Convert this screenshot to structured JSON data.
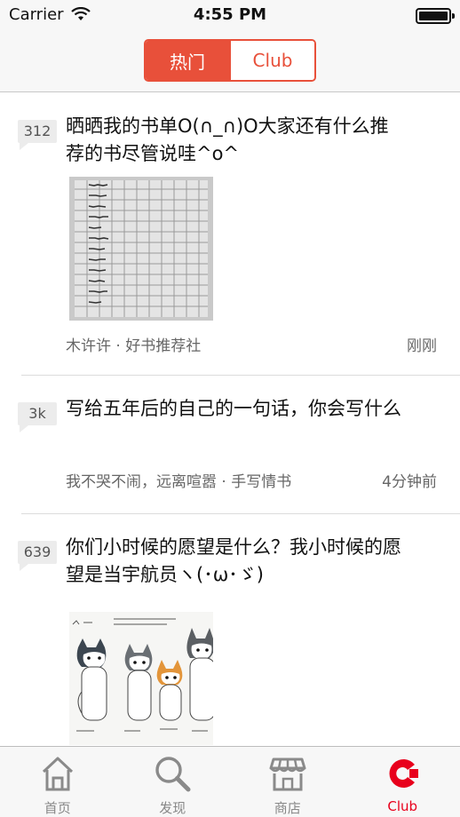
{
  "status_bar": {
    "carrier": "Carrier",
    "time": "4:55 PM"
  },
  "nav": {
    "segments": [
      {
        "label": "热门",
        "selected": true
      },
      {
        "label": "Club",
        "selected": false
      }
    ],
    "accent_color": "#e8503a"
  },
  "posts": [
    {
      "count": "312",
      "title": "晒晒我的书单O(∩_∩)O大家还有什么推荐的书尽管说哇^o^",
      "author_group": "木许许 · 好书推荐社",
      "time": "刚刚",
      "has_image": true,
      "image": "handwritten-book-list-photo"
    },
    {
      "count": "3k",
      "title": "写给五年后的自己的一句话，你会写什么",
      "author_group": "我不哭不闹，远离喧嚣 · 手写情书",
      "time": "4分钟前",
      "has_image": false
    },
    {
      "count": "639",
      "title": "你们小时候的愿望是什么？我小时候的愿望是当宇航员ヽ(･ω･ゞ)",
      "has_image": true,
      "image": "cartoon-dogs-drawing"
    }
  ],
  "tab_bar": {
    "tabs": [
      {
        "label": "首页",
        "icon": "home-icon",
        "selected": false
      },
      {
        "label": "发现",
        "icon": "search-icon",
        "selected": false
      },
      {
        "label": "商店",
        "icon": "store-icon",
        "selected": false
      },
      {
        "label": "Club",
        "icon": "club-icon",
        "selected": true
      }
    ],
    "active_color": "#e8001c",
    "inactive_color": "#888888"
  }
}
